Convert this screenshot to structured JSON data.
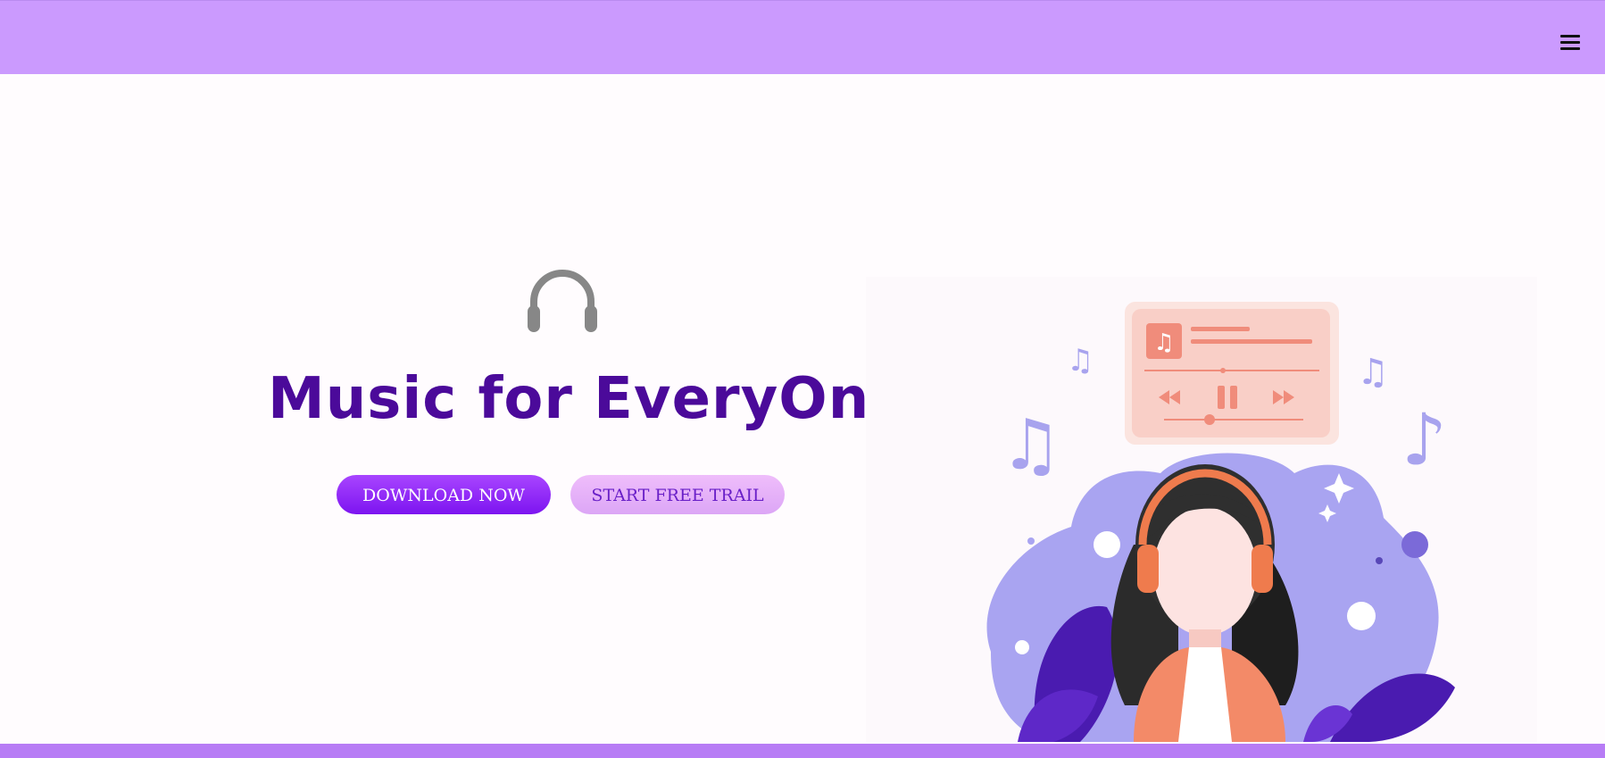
{
  "navbar": {
    "menu_icon": "hamburger-menu-icon",
    "background": "#cb9afe"
  },
  "hero": {
    "icon": "headphones-icon",
    "title": "Music for EveryOne",
    "title_color": "#4b0a9a",
    "buttons": {
      "download_label": "DOWNLOAD NOW",
      "trial_label": "START FREE TRAIL"
    },
    "illustration": "girl-with-headphones-music-player-illustration"
  },
  "footer": {
    "background": "#b77cf5"
  }
}
